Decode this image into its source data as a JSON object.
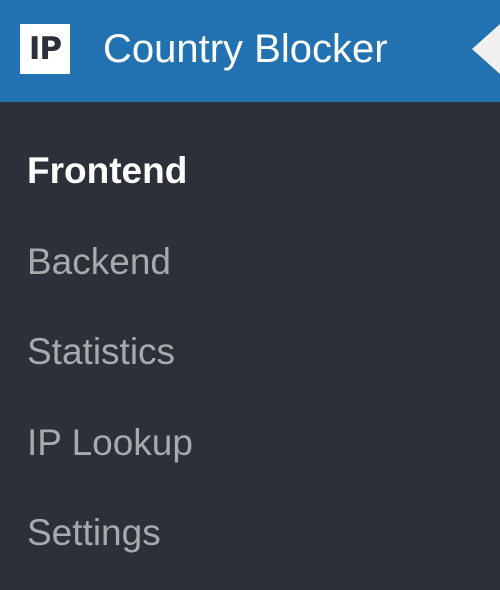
{
  "menu": {
    "logo_text": "IP",
    "title": "Country Blocker",
    "items": [
      {
        "label": "Frontend",
        "current": true
      },
      {
        "label": "Backend",
        "current": false
      },
      {
        "label": "Statistics",
        "current": false
      },
      {
        "label": "IP Lookup",
        "current": false
      },
      {
        "label": "Settings",
        "current": false
      }
    ]
  },
  "colors": {
    "header_bg": "#2271b1",
    "submenu_bg": "#2c3038",
    "active_text": "#ffffff",
    "inactive_text": "#a7aaad"
  }
}
